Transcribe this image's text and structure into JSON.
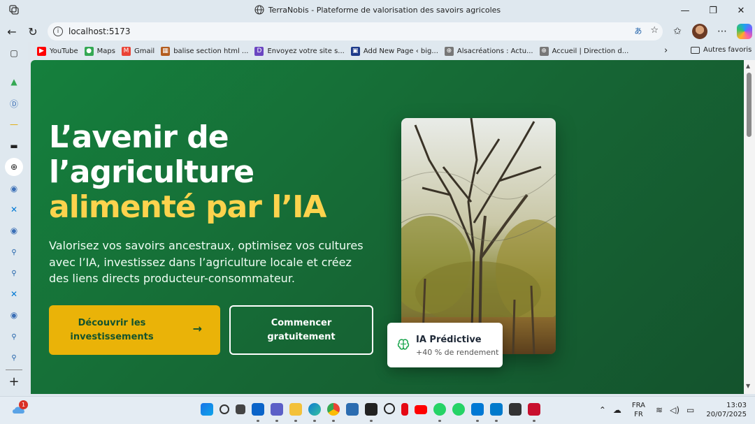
{
  "window": {
    "title": "TerraNobis - Plateforme de valorisation des savoirs agricoles",
    "minimize": "—",
    "maximize": "❐",
    "close": "✕"
  },
  "browser": {
    "url": "localhost:5173",
    "icons": [
      "back-icon",
      "refresh-icon",
      "info-icon",
      "translate-icon",
      "star-icon",
      "favorites-icon",
      "profile-avatar",
      "more-icon",
      "copilot-icon"
    ]
  },
  "bookmarks": {
    "items": [
      {
        "label": "YouTube",
        "color": "#ff0000",
        "glyph": "▶"
      },
      {
        "label": "Maps",
        "color": "#34a853",
        "glyph": "●"
      },
      {
        "label": "Gmail",
        "color": "#ea4335",
        "glyph": "M"
      },
      {
        "label": "balise section html  ...",
        "color": "#b35c1e",
        "glyph": "▦"
      },
      {
        "label": "Envoyez votre site s...",
        "color": "#6b46c1",
        "glyph": "D"
      },
      {
        "label": "Add New Page ‹ big...",
        "color": "#1e3a8a",
        "glyph": "▣"
      },
      {
        "label": "Alsacréations : Actu...",
        "color": "#555555",
        "glyph": "⊕"
      },
      {
        "label": "Accueil | Direction d...",
        "color": "#555555",
        "glyph": "⊕"
      }
    ],
    "more": "›",
    "other_favorites": "Autres favoris"
  },
  "sidebar": {
    "icons": [
      "tab-icon",
      "drive-icon",
      "d-app-icon",
      "dash-icon",
      "terminal-icon",
      "globe-icon",
      "github-icon",
      "vscode-icon",
      "github-icon",
      "search-icon",
      "search-icon",
      "vscode-icon",
      "github-icon",
      "search-icon",
      "search-icon",
      "add-icon"
    ],
    "add": "+"
  },
  "hero": {
    "title_line1": "L’avenir de",
    "title_line2": "l’agriculture",
    "title_highlight": "alimenté par l’IA",
    "description": "Valorisez vos savoirs ancestraux, optimisez vos cultures avec l’IA, investissez dans l’agriculture locale et créez des liens directs producteur-consommateur.",
    "primary_button": "Découvrir les investissements",
    "secondary_button": "Commencer gratuitement",
    "colors": {
      "accent": "#fcd34d",
      "button": "#eab308",
      "bg": "#15803d"
    }
  },
  "ai_card": {
    "title": "IA Prédictive",
    "subtitle": "+40 % de rendement"
  },
  "taskbar": {
    "notification_count": "1",
    "lang_top": "FRA",
    "lang_bottom": "FR",
    "time": "13:03",
    "date": "20/07/2025"
  }
}
